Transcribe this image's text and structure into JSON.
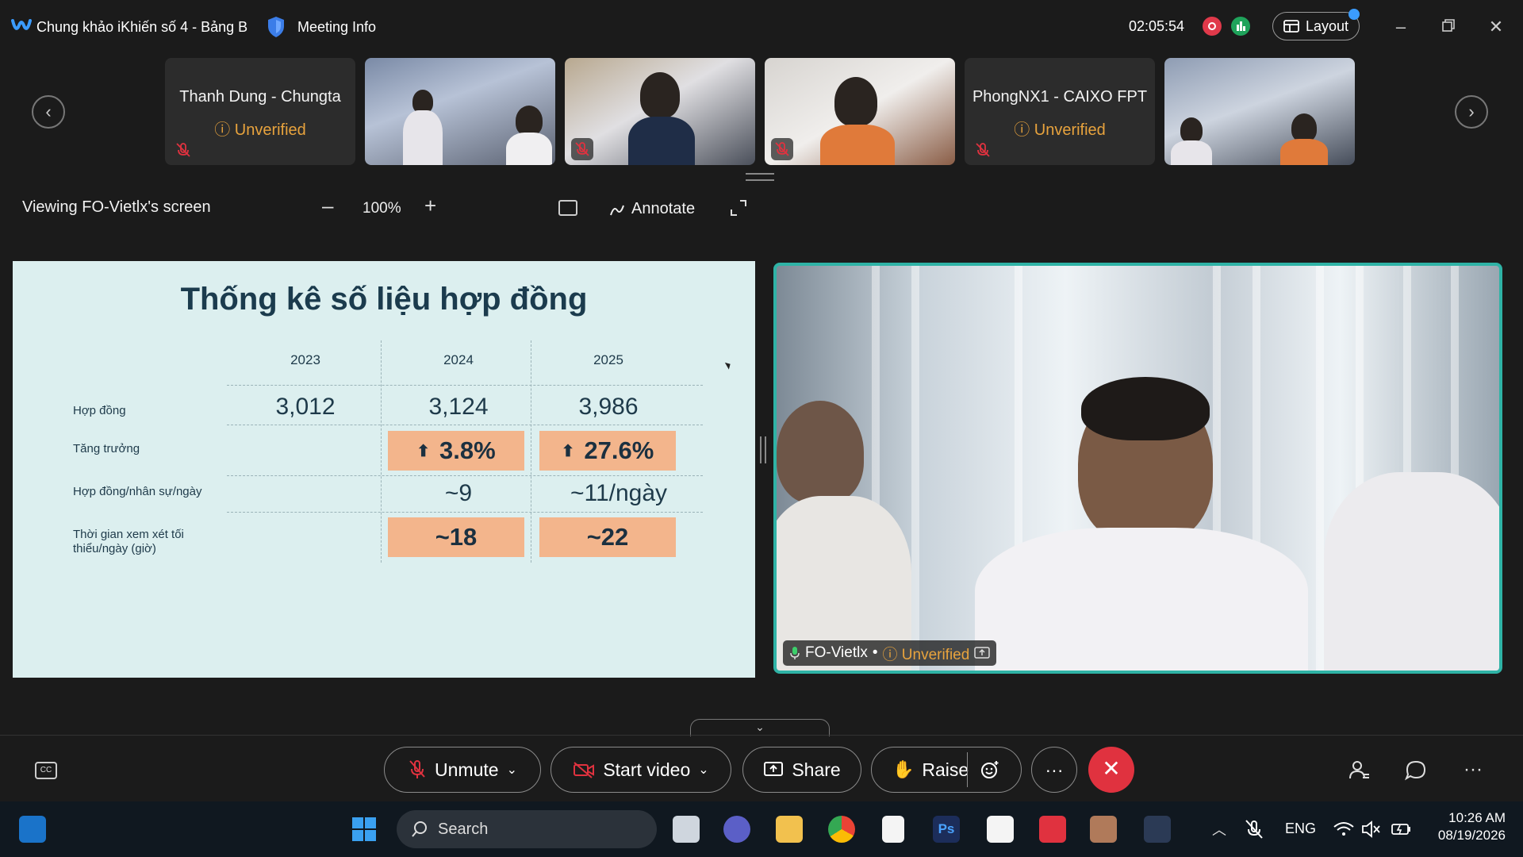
{
  "titlebar": {
    "title": "Chung khảo iKhiến số 4 - Bảng B",
    "meeting_info": "Meeting Info",
    "timer": "02:05:54",
    "layout_label": "Layout"
  },
  "participants": [
    {
      "name": "Thanh Dung - Chungta",
      "status": "Unverified",
      "muted": true
    },
    {
      "name": "",
      "video": true,
      "muted": false
    },
    {
      "name": "",
      "video": true,
      "muted": true
    },
    {
      "name": "",
      "video": true,
      "muted": true
    },
    {
      "name": "PhongNX1 - CAIXO FPT",
      "status": "Unverified",
      "muted": true
    },
    {
      "name": "",
      "video": true,
      "muted": false
    }
  ],
  "viewer": {
    "viewing_label": "Viewing FO-Vietlx's screen",
    "zoom": "100%",
    "annotate_label": "Annotate"
  },
  "slide": {
    "title": "Thống kê số liệu hợp đồng",
    "columns": [
      "2023",
      "2024",
      "2025"
    ],
    "rows": [
      {
        "label": "Hợp đồng",
        "values": [
          "3,012",
          "3,124",
          "3,986"
        ]
      },
      {
        "label": "Tăng trưởng",
        "values": [
          "",
          "3.8%",
          "27.6%"
        ]
      },
      {
        "label": "Hợp đồng/nhân sự/ngày",
        "values": [
          "",
          "~9",
          "~11/ngày"
        ]
      },
      {
        "label": "Thời gian xem xét tối thiểu/ngày (giờ)",
        "values": [
          "",
          "~18",
          "~22"
        ]
      }
    ]
  },
  "speaker": {
    "name": "FO-Vietlx",
    "status": "Unverified"
  },
  "controls": {
    "unmute": "Unmute",
    "start_video": "Start video",
    "share": "Share",
    "raise": "Raise",
    "more": "···"
  },
  "taskbar": {
    "search_placeholder": "Search",
    "language": "ENG",
    "time": "10:26 AM",
    "date": "08/19/2026"
  },
  "colors": {
    "accent_teal": "#2fb3a6",
    "highlight_cell": "#f3b58c",
    "end_call": "#e0323f",
    "unverified": "#e8a33d"
  }
}
